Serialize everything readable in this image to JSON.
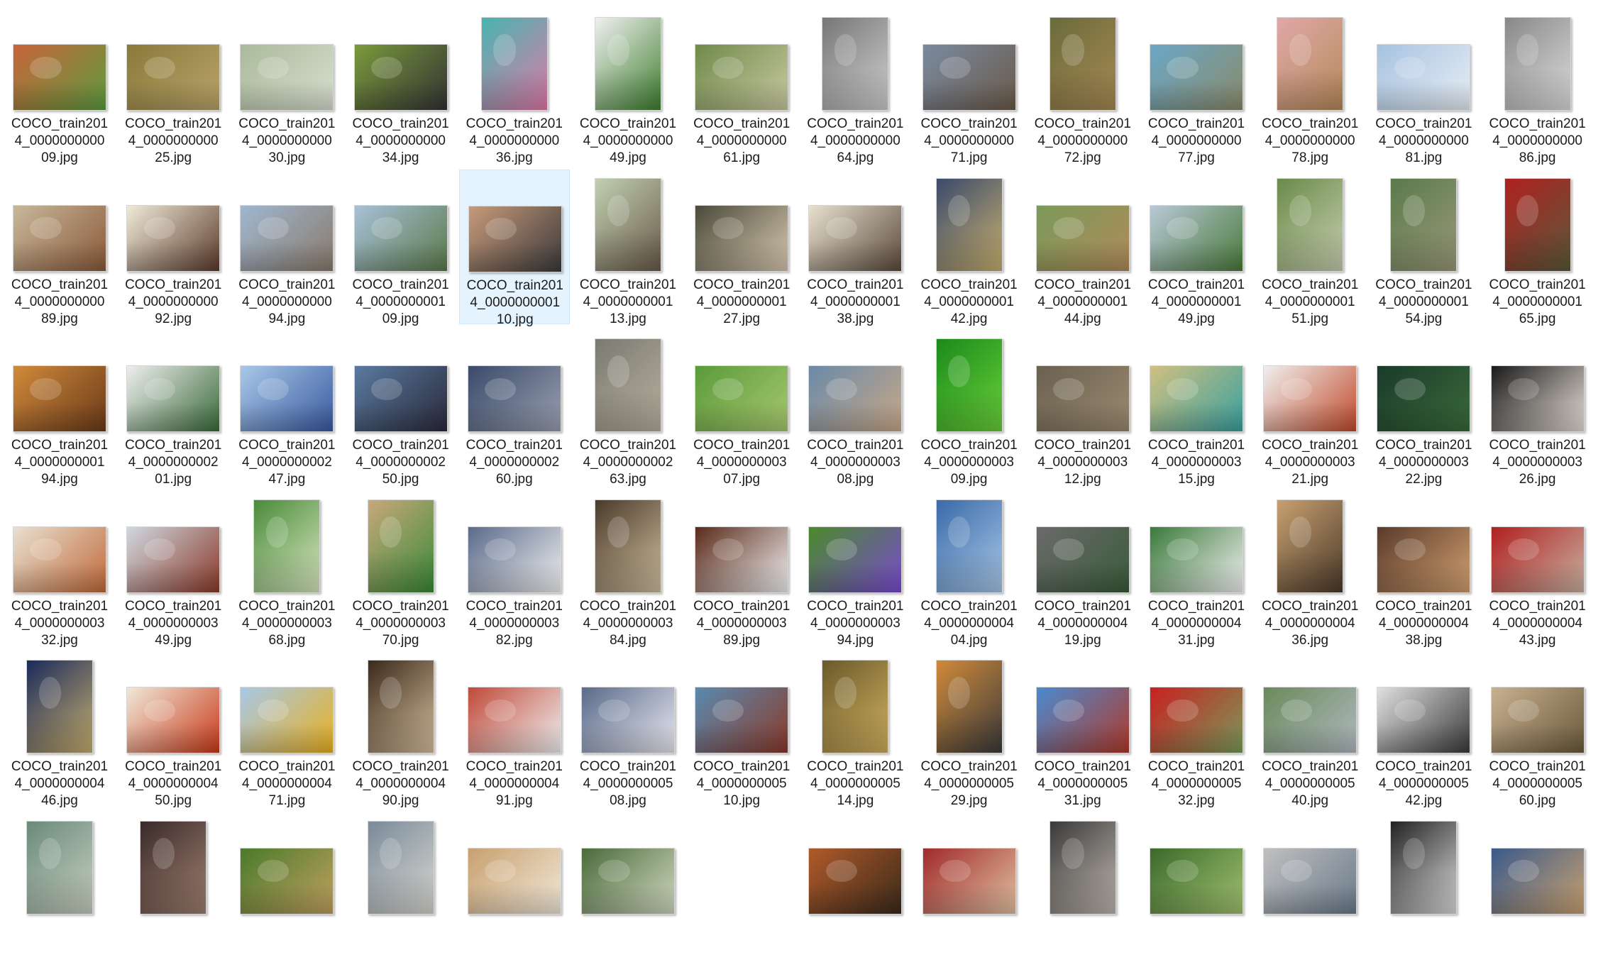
{
  "items": [
    {
      "l1": "COCO_train201",
      "l2": "4_0000000000",
      "l3": "09.jpg",
      "colors": [
        "#c8643a",
        "#5f9b3f"
      ],
      "orient": "land"
    },
    {
      "l1": "COCO_train201",
      "l2": "4_0000000000",
      "l3": "25.jpg",
      "colors": [
        "#8a7a3a",
        "#b9a36a"
      ],
      "orient": "land"
    },
    {
      "l1": "COCO_train201",
      "l2": "4_0000000000",
      "l3": "30.jpg",
      "colors": [
        "#a9b99a",
        "#d9dfd0"
      ],
      "orient": "land"
    },
    {
      "l1": "COCO_train201",
      "l2": "4_0000000000",
      "l3": "34.jpg",
      "colors": [
        "#7a9a3c",
        "#333333"
      ],
      "orient": "land"
    },
    {
      "l1": "COCO_train201",
      "l2": "4_0000000000",
      "l3": "36.jpg",
      "colors": [
        "#46b5b0",
        "#e07aa8"
      ],
      "orient": "port"
    },
    {
      "l1": "COCO_train201",
      "l2": "4_0000000000",
      "l3": "49.jpg",
      "colors": [
        "#f0f0f0",
        "#3f7f2f"
      ],
      "orient": "port"
    },
    {
      "l1": "COCO_train201",
      "l2": "4_0000000000",
      "l3": "61.jpg",
      "colors": [
        "#6f8a4a",
        "#c9c9a0"
      ],
      "orient": "land"
    },
    {
      "l1": "COCO_train201",
      "l2": "4_0000000000",
      "l3": "64.jpg",
      "colors": [
        "#777777",
        "#cfcfcf"
      ],
      "orient": "port"
    },
    {
      "l1": "COCO_train201",
      "l2": "4_0000000000",
      "l3": "71.jpg",
      "colors": [
        "#7a8aa0",
        "#6a5a4a"
      ],
      "orient": "land"
    },
    {
      "l1": "COCO_train201",
      "l2": "4_0000000000",
      "l3": "72.jpg",
      "colors": [
        "#6a6a3a",
        "#a88a55"
      ],
      "orient": "port"
    },
    {
      "l1": "COCO_train201",
      "l2": "4_0000000000",
      "l3": "77.jpg",
      "colors": [
        "#6aa7c7",
        "#8a8a6a"
      ],
      "orient": "land"
    },
    {
      "l1": "COCO_train201",
      "l2": "4_0000000000",
      "l3": "78.jpg",
      "colors": [
        "#e0a8a8",
        "#b58a5a"
      ],
      "orient": "port"
    },
    {
      "l1": "COCO_train201",
      "l2": "4_0000000000",
      "l3": "81.jpg",
      "colors": [
        "#a6c2e0",
        "#e8eef5"
      ],
      "orient": "land"
    },
    {
      "l1": "COCO_train201",
      "l2": "4_0000000000",
      "l3": "86.jpg",
      "colors": [
        "#888888",
        "#dddddd"
      ],
      "orient": "port"
    },
    {
      "l1": "COCO_train201",
      "l2": "4_0000000000",
      "l3": "89.jpg",
      "colors": [
        "#c8b79a",
        "#8a5a3a"
      ],
      "orient": "land"
    },
    {
      "l1": "COCO_train201",
      "l2": "4_0000000000",
      "l3": "92.jpg",
      "colors": [
        "#f0ead8",
        "#5a3a2a"
      ],
      "orient": "land"
    },
    {
      "l1": "COCO_train201",
      "l2": "4_0000000000",
      "l3": "94.jpg",
      "colors": [
        "#9fb7d0",
        "#8a7a6a"
      ],
      "orient": "land"
    },
    {
      "l1": "COCO_train201",
      "l2": "4_0000000001",
      "l3": "09.jpg",
      "colors": [
        "#a8c0d8",
        "#5a7a4a"
      ],
      "orient": "land"
    },
    {
      "l1": "COCO_train201",
      "l2": "4_0000000001",
      "l3": "10.jpg",
      "colors": [
        "#c89a7a",
        "#3a3a3a"
      ],
      "orient": "land",
      "selected": true
    },
    {
      "l1": "COCO_train201",
      "l2": "4_0000000001",
      "l3": "13.jpg",
      "colors": [
        "#c0d0b0",
        "#6a5a4a"
      ],
      "orient": "port"
    },
    {
      "l1": "COCO_train201",
      "l2": "4_0000000001",
      "l3": "27.jpg",
      "colors": [
        "#4a4a3a",
        "#d8c8b0"
      ],
      "orient": "land"
    },
    {
      "l1": "COCO_train201",
      "l2": "4_0000000001",
      "l3": "38.jpg",
      "colors": [
        "#e8e0d0",
        "#5a4a3a"
      ],
      "orient": "land"
    },
    {
      "l1": "COCO_train201",
      "l2": "4_0000000001",
      "l3": "42.jpg",
      "colors": [
        "#3a4a6a",
        "#c8b070"
      ],
      "orient": "port"
    },
    {
      "l1": "COCO_train201",
      "l2": "4_0000000001",
      "l3": "44.jpg",
      "colors": [
        "#7a9a5a",
        "#b08a5a"
      ],
      "orient": "land"
    },
    {
      "l1": "COCO_train201",
      "l2": "4_0000000001",
      "l3": "49.jpg",
      "colors": [
        "#b8c8d8",
        "#4a7a3a"
      ],
      "orient": "land"
    },
    {
      "l1": "COCO_train201",
      "l2": "4_0000000001",
      "l3": "51.jpg",
      "colors": [
        "#6a8a4a",
        "#c8d0b0"
      ],
      "orient": "port"
    },
    {
      "l1": "COCO_train201",
      "l2": "4_0000000001",
      "l3": "54.jpg",
      "colors": [
        "#5a7a4a",
        "#9a9a7a"
      ],
      "orient": "port"
    },
    {
      "l1": "COCO_train201",
      "l2": "4_0000000001",
      "l3": "65.jpg",
      "colors": [
        "#b02020",
        "#5a5a3a"
      ],
      "orient": "port"
    },
    {
      "l1": "COCO_train201",
      "l2": "4_0000000001",
      "l3": "94.jpg",
      "colors": [
        "#d08a3a",
        "#6a3a1a"
      ],
      "orient": "land"
    },
    {
      "l1": "COCO_train201",
      "l2": "4_0000000002",
      "l3": "01.jpg",
      "colors": [
        "#eeeeee",
        "#3a6a3a"
      ],
      "orient": "land"
    },
    {
      "l1": "COCO_train201",
      "l2": "4_0000000002",
      "l3": "47.jpg",
      "colors": [
        "#a8c8e8",
        "#3a5aa0"
      ],
      "orient": "land"
    },
    {
      "l1": "COCO_train201",
      "l2": "4_0000000002",
      "l3": "50.jpg",
      "colors": [
        "#5a7aa0",
        "#2a2a3a"
      ],
      "orient": "land"
    },
    {
      "l1": "COCO_train201",
      "l2": "4_0000000002",
      "l3": "60.jpg",
      "colors": [
        "#3a4a6a",
        "#9aa0b0"
      ],
      "orient": "land"
    },
    {
      "l1": "COCO_train201",
      "l2": "4_0000000002",
      "l3": "63.jpg",
      "colors": [
        "#7a7a70",
        "#b8b0a0"
      ],
      "orient": "port"
    },
    {
      "l1": "COCO_train201",
      "l2": "4_0000000003",
      "l3": "07.jpg",
      "colors": [
        "#5a9a3a",
        "#a8c870"
      ],
      "orient": "land"
    },
    {
      "l1": "COCO_train201",
      "l2": "4_0000000003",
      "l3": "08.jpg",
      "colors": [
        "#6a8aa8",
        "#c8a888"
      ],
      "orient": "land"
    },
    {
      "l1": "COCO_train201",
      "l2": "4_0000000003",
      "l3": "09.jpg",
      "colors": [
        "#1a8a1a",
        "#6ad03a"
      ],
      "orient": "port"
    },
    {
      "l1": "COCO_train201",
      "l2": "4_0000000003",
      "l3": "12.jpg",
      "colors": [
        "#6a6050",
        "#9a8a70"
      ],
      "orient": "land"
    },
    {
      "l1": "COCO_train201",
      "l2": "4_0000000003",
      "l3": "15.jpg",
      "colors": [
        "#d0c080",
        "#3aa0a0"
      ],
      "orient": "land"
    },
    {
      "l1": "COCO_train201",
      "l2": "4_0000000003",
      "l3": "21.jpg",
      "colors": [
        "#f0f0f0",
        "#c04a2a"
      ],
      "orient": "land"
    },
    {
      "l1": "COCO_train201",
      "l2": "4_0000000003",
      "l3": "22.jpg",
      "colors": [
        "#1a3a2a",
        "#3a6a3a"
      ],
      "orient": "land"
    },
    {
      "l1": "COCO_train201",
      "l2": "4_0000000003",
      "l3": "26.jpg",
      "colors": [
        "#1a1a1a",
        "#e8e0d8"
      ],
      "orient": "land"
    },
    {
      "l1": "COCO_train201",
      "l2": "4_0000000003",
      "l3": "32.jpg",
      "colors": [
        "#e8e0d0",
        "#c06a3a"
      ],
      "orient": "land"
    },
    {
      "l1": "COCO_train201",
      "l2": "4_0000000003",
      "l3": "49.jpg",
      "colors": [
        "#d0d8e0",
        "#8a3a2a"
      ],
      "orient": "land"
    },
    {
      "l1": "COCO_train201",
      "l2": "4_0000000003",
      "l3": "68.jpg",
      "colors": [
        "#4a8a3a",
        "#d8e8c0"
      ],
      "orient": "port"
    },
    {
      "l1": "COCO_train201",
      "l2": "4_0000000003",
      "l3": "70.jpg",
      "colors": [
        "#c8a87a",
        "#3a8a3a"
      ],
      "orient": "port"
    },
    {
      "l1": "COCO_train201",
      "l2": "4_0000000003",
      "l3": "82.jpg",
      "colors": [
        "#5a6a8a",
        "#f0f0f0"
      ],
      "orient": "land"
    },
    {
      "l1": "COCO_train201",
      "l2": "4_0000000003",
      "l3": "84.jpg",
      "colors": [
        "#4a3a2a",
        "#d0c0a0"
      ],
      "orient": "port"
    },
    {
      "l1": "COCO_train201",
      "l2": "4_0000000003",
      "l3": "89.jpg",
      "colors": [
        "#5a2a1a",
        "#f0f0f0"
      ],
      "orient": "land"
    },
    {
      "l1": "COCO_train201",
      "l2": "4_0000000003",
      "l3": "94.jpg",
      "colors": [
        "#4a8a2a",
        "#7a4ad0"
      ],
      "orient": "land"
    },
    {
      "l1": "COCO_train201",
      "l2": "4_0000000004",
      "l3": "04.jpg",
      "colors": [
        "#3a6aa8",
        "#a8c8e8"
      ],
      "orient": "port"
    },
    {
      "l1": "COCO_train201",
      "l2": "4_0000000004",
      "l3": "19.jpg",
      "colors": [
        "#6a6a6a",
        "#3a5a3a"
      ],
      "orient": "land"
    },
    {
      "l1": "COCO_train201",
      "l2": "4_0000000004",
      "l3": "31.jpg",
      "colors": [
        "#3a7a3a",
        "#f0f0f0"
      ],
      "orient": "land"
    },
    {
      "l1": "COCO_train201",
      "l2": "4_0000000004",
      "l3": "36.jpg",
      "colors": [
        "#c8a070",
        "#4a3a2a"
      ],
      "orient": "port"
    },
    {
      "l1": "COCO_train201",
      "l2": "4_0000000004",
      "l3": "38.jpg",
      "colors": [
        "#5a3a2a",
        "#d0a070"
      ],
      "orient": "land"
    },
    {
      "l1": "COCO_train201",
      "l2": "4_0000000004",
      "l3": "43.jpg",
      "colors": [
        "#b02020",
        "#c8b0a0"
      ],
      "orient": "land"
    },
    {
      "l1": "COCO_train201",
      "l2": "4_0000000004",
      "l3": "46.jpg",
      "colors": [
        "#1a2a5a",
        "#c8b070"
      ],
      "orient": "port"
    },
    {
      "l1": "COCO_train201",
      "l2": "4_0000000004",
      "l3": "50.jpg",
      "colors": [
        "#f0e8d8",
        "#c83a1a"
      ],
      "orient": "land"
    },
    {
      "l1": "COCO_train201",
      "l2": "4_0000000004",
      "l3": "71.jpg",
      "colors": [
        "#a8c8e8",
        "#e8b020"
      ],
      "orient": "land"
    },
    {
      "l1": "COCO_train201",
      "l2": "4_0000000004",
      "l3": "90.jpg",
      "colors": [
        "#3a2a1a",
        "#d8c0a0"
      ],
      "orient": "port"
    },
    {
      "l1": "COCO_train201",
      "l2": "4_0000000004",
      "l3": "91.jpg",
      "colors": [
        "#c04a3a",
        "#f0f0f0"
      ],
      "orient": "land"
    },
    {
      "l1": "COCO_train201",
      "l2": "4_0000000005",
      "l3": "08.jpg",
      "colors": [
        "#5a6a8a",
        "#e8e8f0"
      ],
      "orient": "land"
    },
    {
      "l1": "COCO_train201",
      "l2": "4_0000000005",
      "l3": "10.jpg",
      "colors": [
        "#5a8ab0",
        "#8a3a2a"
      ],
      "orient": "land"
    },
    {
      "l1": "COCO_train201",
      "l2": "4_0000000005",
      "l3": "14.jpg",
      "colors": [
        "#6a5a2a",
        "#d0b060"
      ],
      "orient": "port"
    },
    {
      "l1": "COCO_train201",
      "l2": "4_0000000005",
      "l3": "29.jpg",
      "colors": [
        "#d08a3a",
        "#3a3a3a"
      ],
      "orient": "port"
    },
    {
      "l1": "COCO_train201",
      "l2": "4_0000000005",
      "l3": "31.jpg",
      "colors": [
        "#4a8ad0",
        "#b03a2a"
      ],
      "orient": "land"
    },
    {
      "l1": "COCO_train201",
      "l2": "4_0000000005",
      "l3": "32.jpg",
      "colors": [
        "#c82020",
        "#7a9a5a"
      ],
      "orient": "land"
    },
    {
      "l1": "COCO_train201",
      "l2": "4_0000000005",
      "l3": "40.jpg",
      "colors": [
        "#6a8a5a",
        "#b0b8c0"
      ],
      "orient": "land"
    },
    {
      "l1": "COCO_train201",
      "l2": "4_0000000005",
      "l3": "42.jpg",
      "colors": [
        "#e0e0e0",
        "#3a3a3a"
      ],
      "orient": "land"
    },
    {
      "l1": "COCO_train201",
      "l2": "4_0000000005",
      "l3": "60.jpg",
      "colors": [
        "#c8b090",
        "#6a5a3a"
      ],
      "orient": "land"
    }
  ],
  "partial_row": [
    {
      "colors": [
        "#6a8a7a",
        "#c8d0c0"
      ],
      "orient": "port",
      "visible": true
    },
    {
      "colors": [
        "#3a2a2a",
        "#a08070"
      ],
      "orient": "port",
      "visible": true
    },
    {
      "colors": [
        "#4a7a2a",
        "#c0a060"
      ],
      "orient": "land",
      "visible": true
    },
    {
      "colors": [
        "#7a8a9a",
        "#d8d8d0"
      ],
      "orient": "port",
      "visible": true
    },
    {
      "colors": [
        "#c8a070",
        "#f0e8d8"
      ],
      "orient": "land",
      "visible": true
    },
    {
      "colors": [
        "#4a6a3a",
        "#d0d8c0"
      ],
      "orient": "land",
      "visible": true
    },
    {
      "colors": [
        "#ffffff",
        "#ffffff"
      ],
      "orient": "land",
      "visible": false
    },
    {
      "colors": [
        "#b05a2a",
        "#3a2a1a"
      ],
      "orient": "land",
      "visible": true
    },
    {
      "colors": [
        "#a02a2a",
        "#e0c0a0"
      ],
      "orient": "land",
      "visible": true
    },
    {
      "colors": [
        "#3a3a3a",
        "#c0b8b0"
      ],
      "orient": "port",
      "visible": true
    },
    {
      "colors": [
        "#3a6a2a",
        "#a0c070"
      ],
      "orient": "land",
      "visible": true
    },
    {
      "colors": [
        "#c0c0c0",
        "#6a7a8a"
      ],
      "orient": "land",
      "visible": true
    },
    {
      "colors": [
        "#222222",
        "#dddddd"
      ],
      "orient": "port",
      "visible": true
    },
    {
      "colors": [
        "#3a5a8a",
        "#c8a070"
      ],
      "orient": "land",
      "visible": true
    }
  ]
}
